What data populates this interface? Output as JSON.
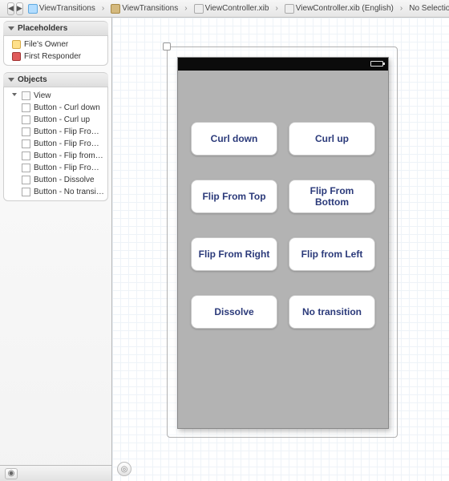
{
  "breadcrumb": {
    "project": "ViewTransitions",
    "folder": "ViewTransitions",
    "xib": "ViewController.xib",
    "local": "ViewController.xib (English)",
    "selection": "No Selection"
  },
  "sidebar": {
    "placeholders_title": "Placeholders",
    "objects_title": "Objects",
    "files_owner": "File's Owner",
    "first_responder": "First Responder",
    "view": "View",
    "buttons": [
      "Button - Curl down",
      "Button - Curl up",
      "Button - Flip From Top",
      "Button - Flip From Bo...",
      "Button - Flip from Left",
      "Button - Flip From Right",
      "Button - Dissolve",
      "Button - No transition"
    ]
  },
  "canvas": {
    "buttons": [
      "Curl down",
      "Curl up",
      "Flip From Top",
      "Flip From Bottom",
      "Flip From Right",
      "Flip from Left",
      "Dissolve",
      "No transition"
    ]
  }
}
